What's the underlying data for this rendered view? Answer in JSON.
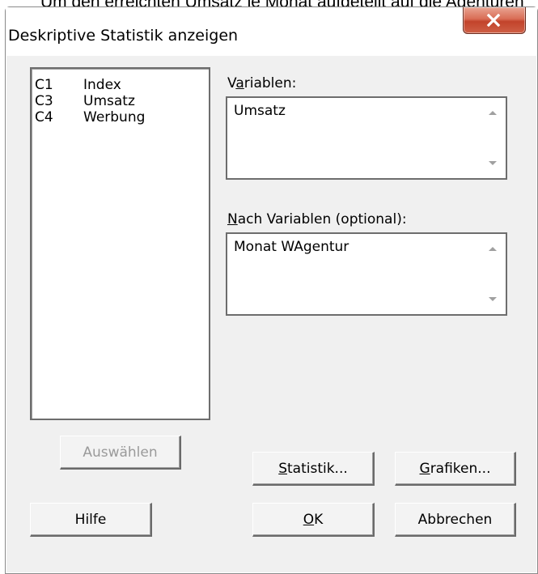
{
  "background_text": "Um den erreichten Umsatz je Monat aufgeteilt auf die Agenturen",
  "window": {
    "title": "Deskriptive Statistik anzeigen",
    "close_icon": "close-x-icon"
  },
  "columns": [
    {
      "id": "C1",
      "name": "Index"
    },
    {
      "id": "C3",
      "name": "Umsatz"
    },
    {
      "id": "C4",
      "name": "Werbung"
    }
  ],
  "variables": {
    "label_pre": "V",
    "label_ul": "a",
    "label_post": "riablen:",
    "value": "Umsatz"
  },
  "by_variables": {
    "label_ul": "N",
    "label_post": "ach Variablen (optional):",
    "value": "Monat WAgentur"
  },
  "buttons": {
    "select": "Auswählen",
    "statistik_ul": "S",
    "statistik_rest": "tatistik...",
    "grafiken_ul": "G",
    "grafiken_rest": "rafiken...",
    "help": "Hilfe",
    "ok_ul": "O",
    "ok_rest": "K",
    "cancel": "Abbrechen"
  },
  "colors": {
    "dialog_bg": "#f0f0f0",
    "close_button": "#c2432b",
    "disabled_text": "#9a9a9a"
  }
}
